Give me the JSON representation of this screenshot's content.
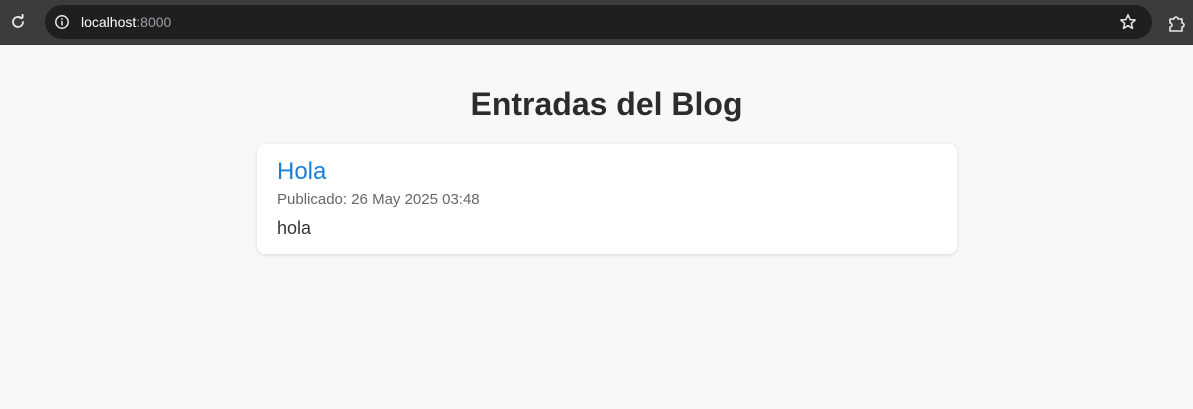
{
  "browser": {
    "url_host": "localhost",
    "url_port": ":8000"
  },
  "page": {
    "title": "Entradas del Blog"
  },
  "posts": [
    {
      "title": "Hola",
      "meta_prefix": "Publicado: ",
      "date": "26 May 2025 03:48",
      "body": "hola"
    }
  ],
  "colors": {
    "background": "#f8f8f8",
    "toolbar": "#3c3c3c",
    "url_box": "#1f1f1f",
    "link": "#1a7fd6",
    "heading": "#2c2c2c"
  }
}
